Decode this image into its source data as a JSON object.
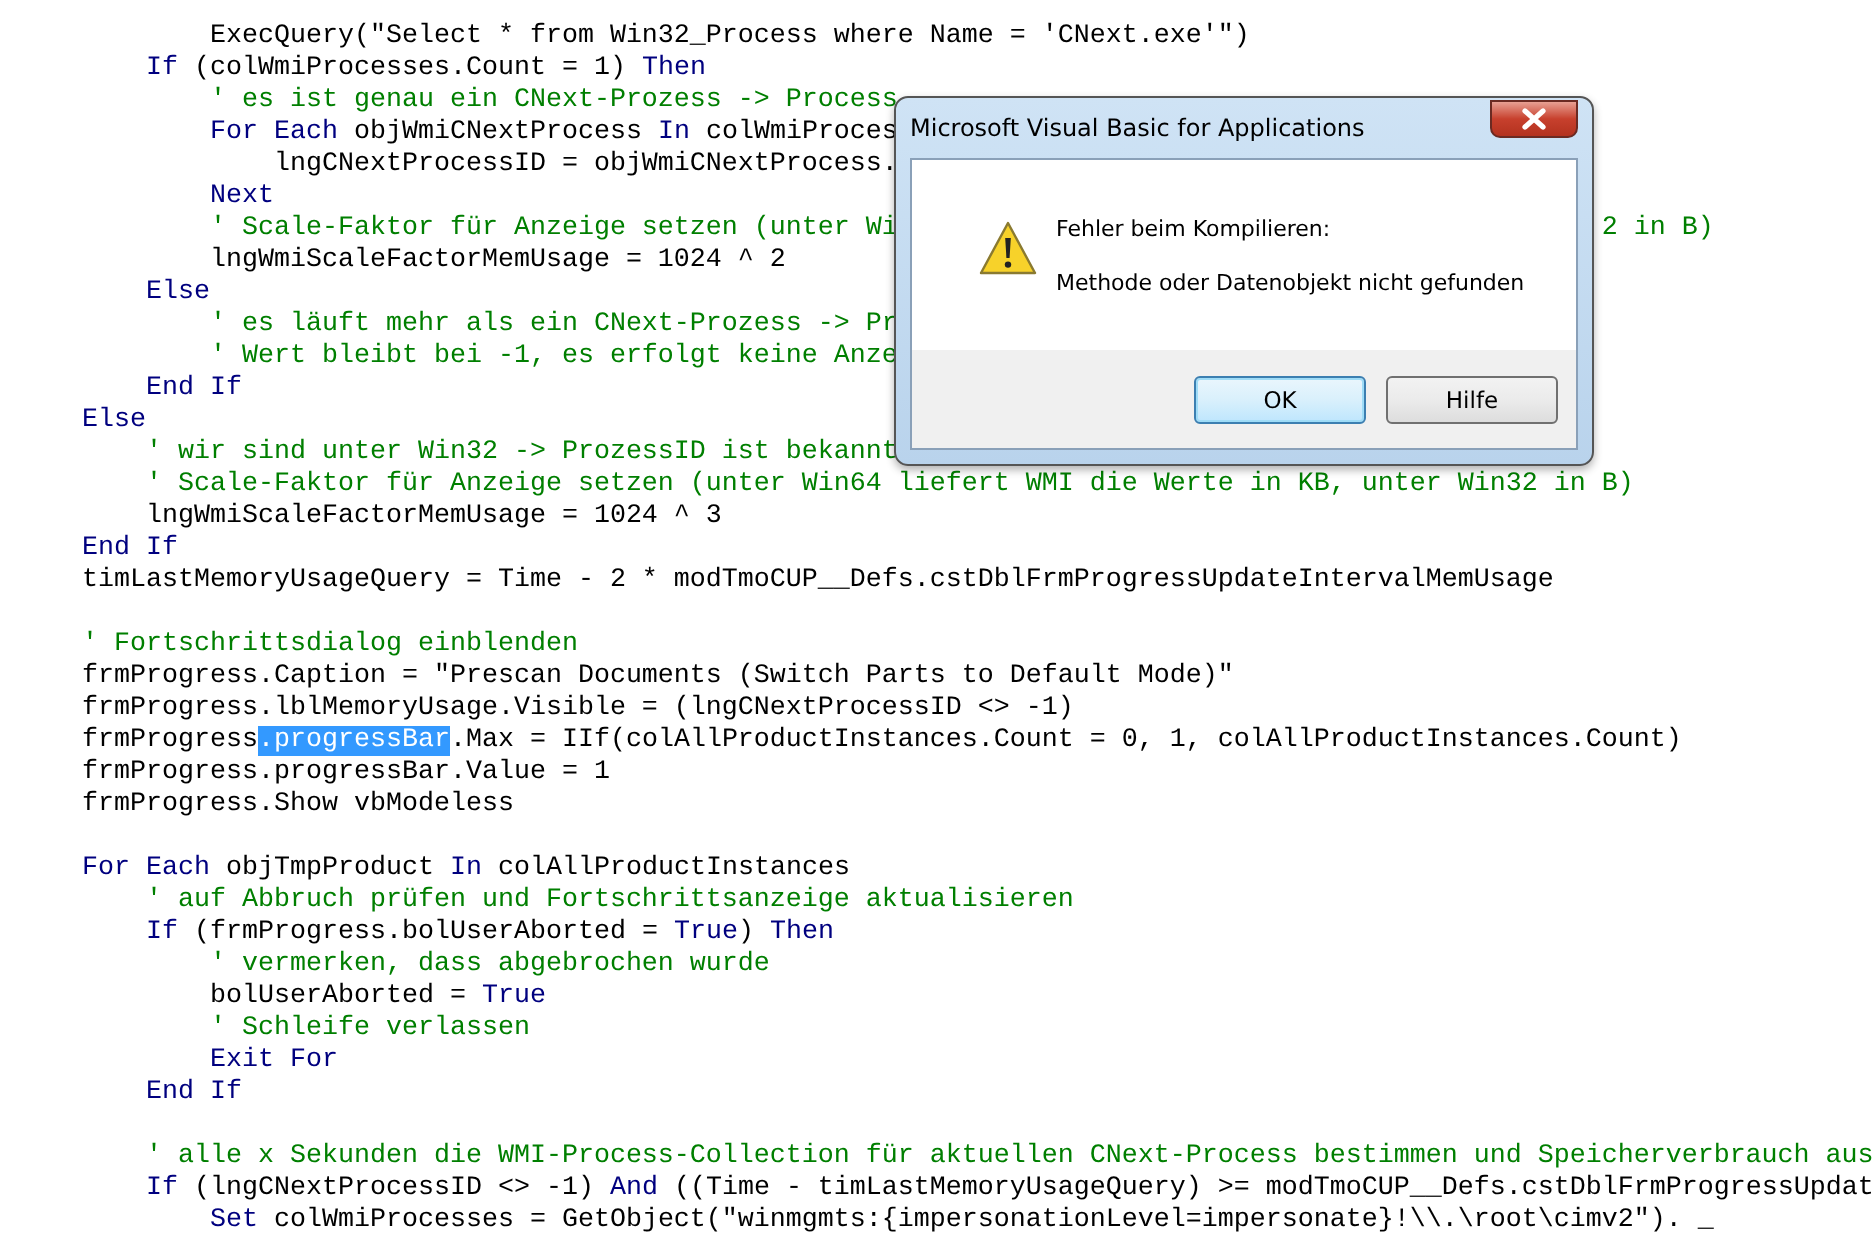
{
  "editor": {
    "lines": [
      {
        "kind": "code",
        "segments": [
          {
            "kind": "plain",
            "text": "        ExecQuery(\"Select * from Win32_Process where Name = 'CNext.exe'\")"
          }
        ]
      },
      {
        "kind": "code",
        "segments": [
          {
            "kind": "keyword",
            "text": "    If"
          },
          {
            "kind": "plain",
            "text": " (colWmiProcesses.Count = 1) "
          },
          {
            "kind": "keyword",
            "text": "Then"
          }
        ]
      },
      {
        "kind": "code",
        "segments": [
          {
            "kind": "comment",
            "text": "        ' es ist genau ein CNext-Prozess -> Process"
          }
        ]
      },
      {
        "kind": "code",
        "segments": [
          {
            "kind": "keyword",
            "text": "        For Each"
          },
          {
            "kind": "plain",
            "text": " objWmiCNextProcess "
          },
          {
            "kind": "keyword",
            "text": "In"
          },
          {
            "kind": "plain",
            "text": " colWmiProces"
          }
        ]
      },
      {
        "kind": "code",
        "segments": [
          {
            "kind": "plain",
            "text": "            lngCNextProcessID = objWmiCNextProcess."
          }
        ]
      },
      {
        "kind": "code",
        "segments": [
          {
            "kind": "keyword",
            "text": "        Next"
          }
        ]
      },
      {
        "kind": "split",
        "segments": [
          {
            "kind": "comment",
            "text": "        ' Scale-Faktor für Anzeige setzen (unter Wi"
          },
          {
            "kind": "comment",
            "text": "2 in B)"
          }
        ]
      },
      {
        "kind": "code",
        "segments": [
          {
            "kind": "plain",
            "text": "        lngWmiScaleFactorMemUsage = 1024 ^ 2"
          }
        ]
      },
      {
        "kind": "code",
        "segments": [
          {
            "kind": "keyword",
            "text": "    Else"
          }
        ]
      },
      {
        "kind": "code",
        "segments": [
          {
            "kind": "comment",
            "text": "        ' es läuft mehr als ein CNext-Prozess -> Pr"
          }
        ]
      },
      {
        "kind": "code",
        "segments": [
          {
            "kind": "comment",
            "text": "        ' Wert bleibt bei -1, es erfolgt keine Anze"
          }
        ]
      },
      {
        "kind": "code",
        "segments": [
          {
            "kind": "keyword",
            "text": "    End If"
          }
        ]
      },
      {
        "kind": "code",
        "segments": [
          {
            "kind": "keyword",
            "text": "Else"
          }
        ]
      },
      {
        "kind": "code",
        "segments": [
          {
            "kind": "comment",
            "text": "    ' wir sind unter Win32 -> ProzessID ist bekannt"
          }
        ]
      },
      {
        "kind": "code",
        "segments": [
          {
            "kind": "comment",
            "text": "    ' Scale-Faktor für Anzeige setzen (unter Win64 liefert WMI die Werte in KB, unter Win32 in B)"
          }
        ]
      },
      {
        "kind": "code",
        "segments": [
          {
            "kind": "plain",
            "text": "    lngWmiScaleFactorMemUsage = 1024 ^ 3"
          }
        ]
      },
      {
        "kind": "code",
        "segments": [
          {
            "kind": "keyword",
            "text": "End If"
          }
        ]
      },
      {
        "kind": "code",
        "segments": [
          {
            "kind": "plain",
            "text": "timLastMemoryUsageQuery = Time - 2 * modTmoCUP__Defs.cstDblFrmProgressUpdateIntervalMemUsage"
          }
        ]
      },
      {
        "kind": "blank"
      },
      {
        "kind": "code",
        "segments": [
          {
            "kind": "comment",
            "text": "' Fortschrittsdialog einblenden"
          }
        ]
      },
      {
        "kind": "code",
        "segments": [
          {
            "kind": "plain",
            "text": "frmProgress.Caption = \"Prescan Documents (Switch Parts to Default Mode)\""
          }
        ]
      },
      {
        "kind": "code",
        "segments": [
          {
            "kind": "plain",
            "text": "frmProgress.lblMemoryUsage.Visible = (lngCNextProcessID <> -1)"
          }
        ]
      },
      {
        "kind": "code",
        "segments": [
          {
            "kind": "plain",
            "text": "frmProgress"
          },
          {
            "kind": "selection",
            "text": ".progressBar"
          },
          {
            "kind": "plain",
            "text": ".Max = IIf(colAllProductInstances.Count = 0, 1, colAllProductInstances.Count)"
          }
        ]
      },
      {
        "kind": "code",
        "segments": [
          {
            "kind": "plain",
            "text": "frmProgress.progressBar.Value = 1"
          }
        ]
      },
      {
        "kind": "code",
        "segments": [
          {
            "kind": "plain",
            "text": "frmProgress.Show vbModeless"
          }
        ]
      },
      {
        "kind": "blank"
      },
      {
        "kind": "code",
        "segments": [
          {
            "kind": "keyword",
            "text": "For Each"
          },
          {
            "kind": "plain",
            "text": " objTmpProduct "
          },
          {
            "kind": "keyword",
            "text": "In"
          },
          {
            "kind": "plain",
            "text": " colAllProductInstances"
          }
        ]
      },
      {
        "kind": "code",
        "segments": [
          {
            "kind": "comment",
            "text": "    ' auf Abbruch prüfen und Fortschrittsanzeige aktualisieren"
          }
        ]
      },
      {
        "kind": "code",
        "segments": [
          {
            "kind": "keyword",
            "text": "    If"
          },
          {
            "kind": "plain",
            "text": " (frmProgress.bolUserAborted = "
          },
          {
            "kind": "keyword",
            "text": "True"
          },
          {
            "kind": "plain",
            "text": ") "
          },
          {
            "kind": "keyword",
            "text": "Then"
          }
        ]
      },
      {
        "kind": "code",
        "segments": [
          {
            "kind": "comment",
            "text": "        ' vermerken, dass abgebrochen wurde"
          }
        ]
      },
      {
        "kind": "code",
        "segments": [
          {
            "kind": "plain",
            "text": "        bolUserAborted = "
          },
          {
            "kind": "keyword",
            "text": "True"
          }
        ]
      },
      {
        "kind": "code",
        "segments": [
          {
            "kind": "comment",
            "text": "        ' Schleife verlassen"
          }
        ]
      },
      {
        "kind": "code",
        "segments": [
          {
            "kind": "keyword",
            "text": "        Exit For"
          }
        ]
      },
      {
        "kind": "code",
        "segments": [
          {
            "kind": "keyword",
            "text": "    End If"
          }
        ]
      },
      {
        "kind": "blank"
      },
      {
        "kind": "code",
        "segments": [
          {
            "kind": "comment",
            "text": "    ' alle x Sekunden die WMI-Process-Collection für aktuellen CNext-Process bestimmen und Speicherverbrauch aus"
          }
        ]
      },
      {
        "kind": "code",
        "segments": [
          {
            "kind": "keyword",
            "text": "    If"
          },
          {
            "kind": "plain",
            "text": " (lngCNextProcessID <> -1) "
          },
          {
            "kind": "keyword",
            "text": "And"
          },
          {
            "kind": "plain",
            "text": " ((Time - timLastMemoryUsageQuery) >= modTmoCUP__Defs.cstDblFrmProgressUpdat"
          }
        ]
      },
      {
        "kind": "code",
        "segments": [
          {
            "kind": "keyword",
            "text": "        Set"
          },
          {
            "kind": "plain",
            "text": " colWmiProcesses = GetObject(\"winmgmts:{impersonationLevel=impersonate}!\\\\.\\root\\cimv2\"). _"
          }
        ]
      }
    ]
  },
  "dialog": {
    "title": "Microsoft Visual Basic for Applications",
    "heading": "Fehler beim Kompilieren:",
    "message": "Methode oder Datenobjekt nicht gefunden",
    "buttons": [
      {
        "label": "OK",
        "selected": true
      },
      {
        "label": "Hilfe",
        "selected": false
      }
    ]
  }
}
